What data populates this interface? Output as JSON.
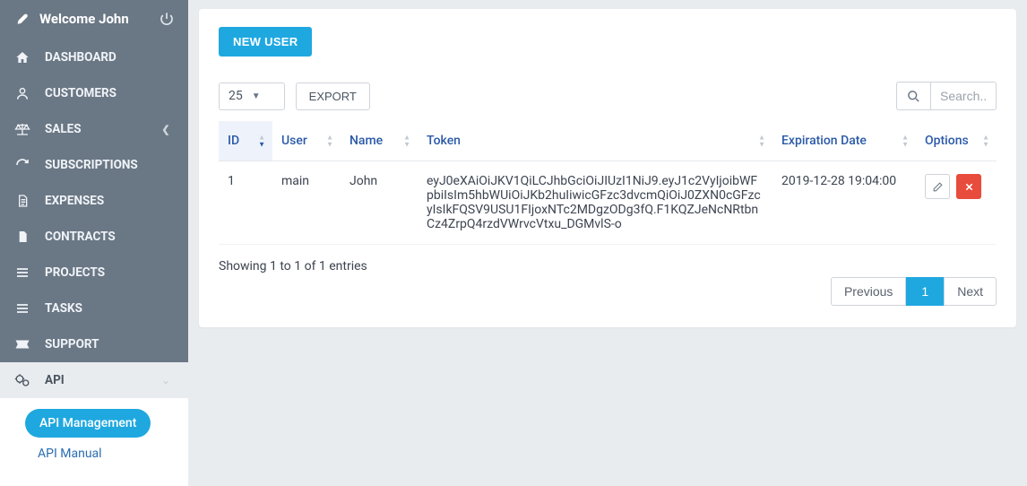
{
  "header": {
    "welcome": "Welcome John"
  },
  "sidebar": {
    "items": [
      {
        "icon": "home",
        "label": "DASHBOARD"
      },
      {
        "icon": "user",
        "label": "CUSTOMERS"
      },
      {
        "icon": "scales",
        "label": "SALES",
        "expandable": true
      },
      {
        "icon": "refresh",
        "label": "SUBSCRIPTIONS"
      },
      {
        "icon": "doc-lines",
        "label": "EXPENSES"
      },
      {
        "icon": "doc",
        "label": "CONTRACTS"
      },
      {
        "icon": "bars",
        "label": "PROJECTS"
      },
      {
        "icon": "bars",
        "label": "TASKS"
      },
      {
        "icon": "ticket",
        "label": "SUPPORT"
      },
      {
        "icon": "cogs",
        "label": "API",
        "expandable": true,
        "active": true
      }
    ],
    "api_sub": {
      "management": "API Management",
      "manual": "API Manual"
    }
  },
  "page": {
    "new_user": "NEW USER",
    "length": "25",
    "export": "EXPORT",
    "search_placeholder": "Search...",
    "columns": {
      "id": "ID",
      "user": "User",
      "name": "Name",
      "token": "Token",
      "expiration": "Expiration Date",
      "options": "Options"
    },
    "rows": [
      {
        "id": "1",
        "user": "main",
        "name": "John",
        "token": "eyJ0eXAiOiJKV1QiLCJhbGciOiJIUzI1NiJ9.eyJ1c2VyIjoibWFpbiIsIm5hbWUiOiJKb2huIiwicGFzc3dvcmQiOiJ0ZXN0cGFzcyIsIkFQSV9USU1FIjoxNTc2MDgzODg3fQ.F1KQZJeNcNRtbnCz4ZrpQ4rzdVWrvcVtxu_DGMvlS-o",
        "expiration": "2019-12-28 19:04:00"
      }
    ],
    "info": "Showing 1 to 1 of 1 entries",
    "pagination": {
      "prev": "Previous",
      "page": "1",
      "next": "Next"
    }
  }
}
